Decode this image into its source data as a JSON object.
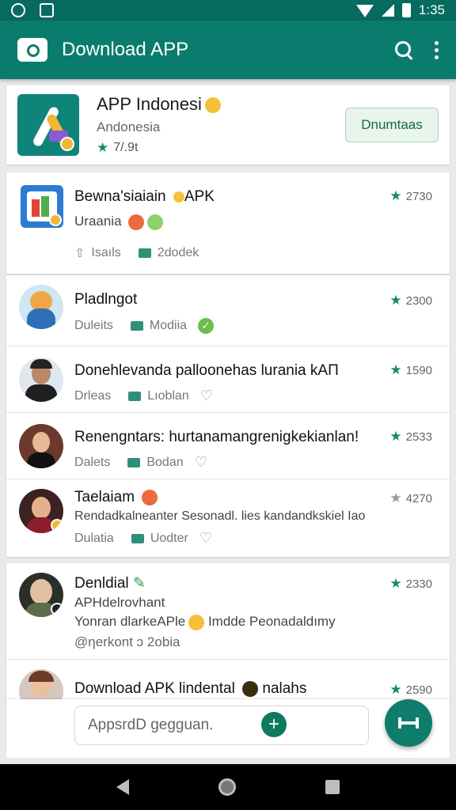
{
  "status_bar": {
    "time": "1:35"
  },
  "app_bar": {
    "title": "Download APP"
  },
  "featured": {
    "title": "APP Indonesi",
    "subtitle": "Andonesia",
    "rating": "7/.9t",
    "button_label": "Dnumtaas"
  },
  "card1": {
    "title": "Bewna'siaiain",
    "title_suffix": "APK",
    "line": "Uraania",
    "meta_a": "Isaıls",
    "meta_b": "2dodek",
    "rating": "2730"
  },
  "card2": {
    "rows": [
      {
        "title": "Pladlngot",
        "meta_a": "Duleits",
        "meta_b": "Modiia",
        "rating": "2300"
      },
      {
        "title": "Donehlevanda palloonehas lurania kAΠ",
        "meta_a": "Drleas",
        "meta_b": "Lıoblan",
        "rating": "1590"
      },
      {
        "title": "Renengntars: hurtanamangrenigkekianlan!",
        "meta_a": "Dalets",
        "meta_b": "Bodan",
        "rating": "2533"
      },
      {
        "title": "Taelaiam",
        "line": "Rendadkalneanter Sesonadl. lies kandandkskiel Iao",
        "meta_a": "Dulatia",
        "meta_b": "Uodter",
        "rating": "4270"
      }
    ]
  },
  "card3": {
    "rows": [
      {
        "title": "Denldial",
        "line1": "APHdelrovhant",
        "line2": "Yonran dlarkeAPle",
        "line2_suffix": "Imdde Peonadaldımy",
        "line3": "@ηerkont ↄ 2obia",
        "rating": "2330"
      },
      {
        "title": "Download APK lindental",
        "title_suffix": "nalahs",
        "rating": "2590"
      }
    ]
  },
  "composer": {
    "placeholder": "AppsrdD gegguan."
  },
  "colors": {
    "primary": "#0a7c6d",
    "status_bar": "#066b5e",
    "star": "#1a8a60",
    "fab": "#0f7d6c"
  }
}
